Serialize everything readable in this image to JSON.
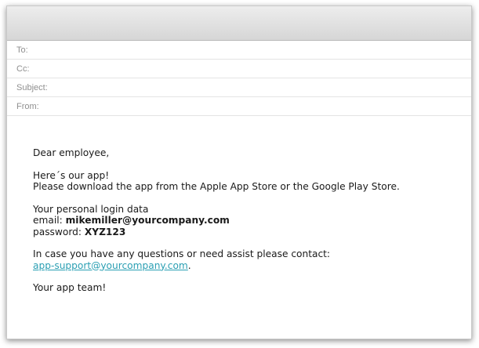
{
  "compose": {
    "fields": {
      "to_label": "To:",
      "to_value": "",
      "cc_label": "Cc:",
      "cc_value": "",
      "subject_label": "Subject:",
      "subject_value": "",
      "from_label": "From:",
      "from_value": ""
    },
    "body": {
      "greeting": "Dear employee,",
      "intro_line_1": "Here´s our app!",
      "intro_line_2": "Please download the app from the Apple App Store or the Google Play Store.",
      "login_heading": "Your personal login data",
      "email_label": "email: ",
      "email_value": "mikemiller@yourcompany.com",
      "password_label": "password: ",
      "password_value": "XYZ123",
      "contact_text": "In case you have any questions or need assist please contact:",
      "support_link": "app-support@yourcompany.com",
      "support_link_suffix": ".",
      "signoff": "Your app team!"
    }
  }
}
